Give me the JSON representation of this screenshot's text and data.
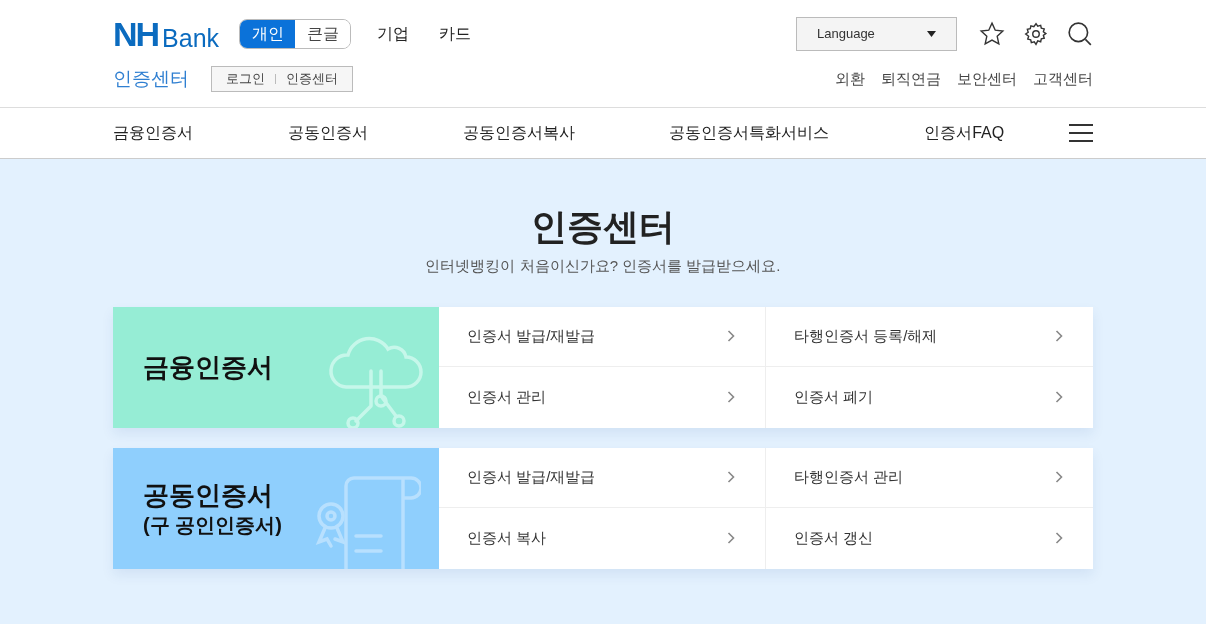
{
  "header": {
    "logo": {
      "mark": "NH",
      "text": "Bank"
    },
    "font_toggle": [
      {
        "label": "개인",
        "selected": true
      },
      {
        "label": "큰글",
        "selected": false
      }
    ],
    "top_links": [
      "기업",
      "카드"
    ],
    "language": {
      "value": "Language"
    },
    "section_title": "인증센터",
    "breadcrumb": [
      "로그인",
      "인증센터"
    ],
    "util_links": [
      "외환",
      "퇴직연금",
      "보안센터",
      "고객센터"
    ]
  },
  "nav": {
    "items": [
      "금융인증서",
      "공동인증서",
      "공동인증서복사",
      "공동인증서특화서비스",
      "인증서FAQ"
    ]
  },
  "hero": {
    "title": "인증센터",
    "subtitle": "인터넷뱅킹이 처음이신가요? 인증서를 발급받으세요."
  },
  "cards": [
    {
      "kind": "cloud",
      "color": "#96edd5",
      "title": "금융인증서",
      "links": [
        "인증서 발급/재발급",
        "타행인증서 등록/해제",
        "인증서 관리",
        "인증서 폐기"
      ]
    },
    {
      "kind": "certificate",
      "color": "#8fcffd",
      "title": "공동인증서",
      "subtitle": "(구 공인인증서)",
      "links": [
        "인증서 발급/재발급",
        "타행인증서 관리",
        "인증서 복사",
        "인증서 갱신"
      ]
    }
  ]
}
